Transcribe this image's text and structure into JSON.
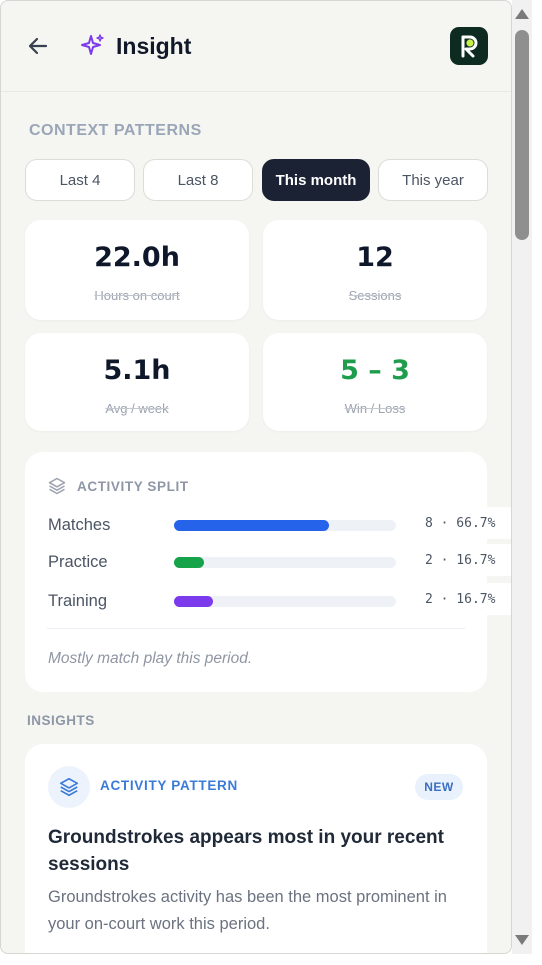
{
  "header": {
    "title": "Insight"
  },
  "context": {
    "label": "CONTEXT PATTERNS",
    "filters": [
      {
        "label": "Last 4",
        "active": false
      },
      {
        "label": "Last 8",
        "active": false
      },
      {
        "label": "This month",
        "active": true
      },
      {
        "label": "This year",
        "active": false
      }
    ]
  },
  "stats": [
    {
      "value": "22.0h",
      "label": "Hours on court"
    },
    {
      "value": "12",
      "label": "Sessions"
    },
    {
      "value": "5.1h",
      "label": "Avg / week"
    },
    {
      "value": "5 – 3",
      "label": "Win / Loss"
    }
  ],
  "activity_split": {
    "title": "ACTIVITY SPLIT",
    "rows": [
      {
        "name": "Matches",
        "value": "8 · 66.7%",
        "fraction": 0.7,
        "color": "#2563eb"
      },
      {
        "name": "Practice",
        "value": "2 · 16.7%",
        "fraction": 0.135,
        "color": "#16a34a"
      },
      {
        "name": "Training",
        "value": "2 · 16.7%",
        "fraction": 0.175,
        "color": "#7c3aed"
      }
    ],
    "note": "Mostly match play this period."
  },
  "insights": {
    "label": "INSIGHTS",
    "card": {
      "kind": "ACTIVITY PATTERN",
      "badge": "NEW",
      "title": "Groundstrokes appears most in your recent sessions",
      "body": "Groundstrokes activity has been the most prominent in your on-court work this period."
    }
  },
  "colors": {
    "accent_dark": "#1b2233",
    "win": "#1e9e4c",
    "brand_logo": "#0e2b22",
    "sparkle": "#7c3aed"
  }
}
